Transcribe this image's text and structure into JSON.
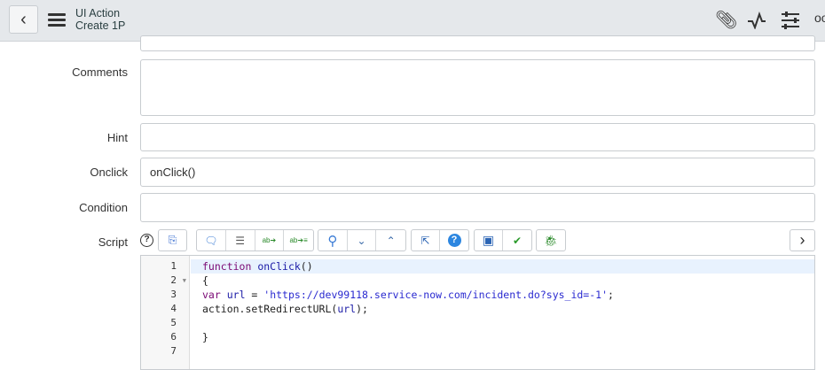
{
  "header": {
    "title": "UI Action",
    "subtitle": "Create 1P"
  },
  "form": {
    "comments_label": "Comments",
    "comments_value": "",
    "hint_label": "Hint",
    "hint_value": "",
    "onclick_label": "Onclick",
    "onclick_value": "onClick()",
    "condition_label": "Condition",
    "condition_value": "",
    "script_label": "Script"
  },
  "editor": {
    "line_numbers": [
      "1",
      "2",
      "3",
      "4",
      "5",
      "6",
      "7"
    ],
    "lines": {
      "l1_kw": "function",
      "l1_fn": "onClick",
      "l1_rest": "()",
      "l2": "{",
      "l3_kw": "var",
      "l3_var": "url",
      "l3_eq": " = ",
      "l3_str": "'https://dev99118.service-now.com/incident.do?sys_id=-1'",
      "l3_end": ";",
      "l4_a": "action.setRedirectURL(",
      "l4_var": "url",
      "l4_b": ");",
      "l5": "",
      "l6": "}",
      "l7": ""
    }
  }
}
